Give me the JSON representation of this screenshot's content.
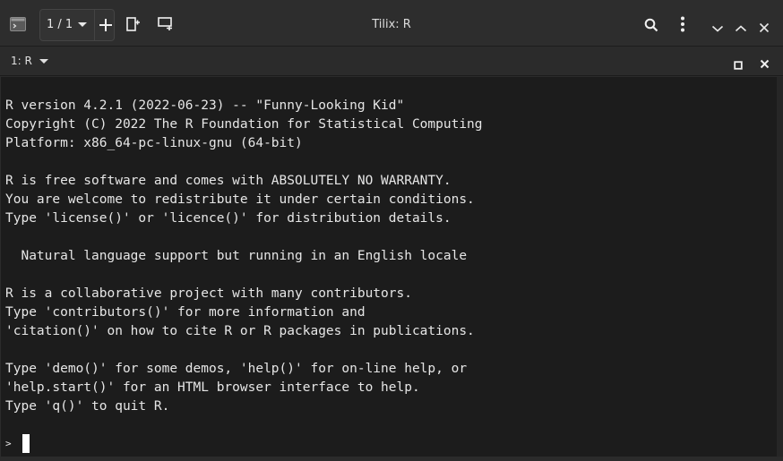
{
  "window": {
    "title": "Tilix: R"
  },
  "header": {
    "app_icon": "terminal-app-icon",
    "session_label": "1 / 1",
    "icons": {
      "new_session": "plus-icon",
      "add_terminal_right": "split-right-icon",
      "add_terminal_down": "split-down-icon",
      "search": "search-icon",
      "menu": "kebab-menu-icon",
      "minimize": "chevron-down-icon",
      "maximize": "chevron-up-icon",
      "close": "close-icon"
    }
  },
  "terminal_tab": {
    "title": "1: R",
    "icons": {
      "maximize": "maximize-square-icon",
      "close": "close-icon"
    }
  },
  "terminal": {
    "lines": [
      "R version 4.2.1 (2022-06-23) -- \"Funny-Looking Kid\"",
      "Copyright (C) 2022 The R Foundation for Statistical Computing",
      "Platform: x86_64-pc-linux-gnu (64-bit)",
      "",
      "R is free software and comes with ABSOLUTELY NO WARRANTY.",
      "You are welcome to redistribute it under certain conditions.",
      "Type 'license()' or 'licence()' for distribution details.",
      "",
      "  Natural language support but running in an English locale",
      "",
      "R is a collaborative project with many contributors.",
      "Type 'contributors()' for more information and",
      "'citation()' on how to cite R or R packages in publications.",
      "",
      "Type 'demo()' for some demos, 'help()' for on-line help, or",
      "'help.start()' for an HTML browser interface to help.",
      "Type 'q()' to quit R.",
      ""
    ],
    "prompt": ">",
    "input": ""
  },
  "colors": {
    "terminal_bg": "#1c1c1c",
    "terminal_fg": "#e6e6e6",
    "headerbar_bg": "#2d2d2d",
    "cursor": "#ffffff"
  }
}
